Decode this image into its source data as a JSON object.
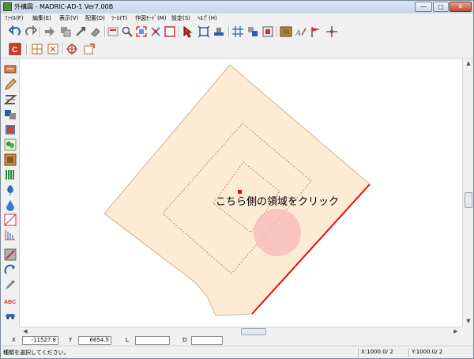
{
  "window": {
    "title": "外構図 - MADRIC-AD-1 Ver7.00B",
    "minimize_glyph": "—",
    "maximize_glyph": "□",
    "close_glyph": "✕"
  },
  "menu": [
    {
      "label": "ﾌｧｲﾙ(F)"
    },
    {
      "label": "編集(E)"
    },
    {
      "label": "表示(V)"
    },
    {
      "label": "配置(D)"
    },
    {
      "label": "ﾂｰﾙ(T)"
    },
    {
      "label": "作図ﾓｰﾄﾞ(M)"
    },
    {
      "label": "設定(S)"
    },
    {
      "label": "ﾍﾙﾌﾟ(H)"
    }
  ],
  "canvas": {
    "instruction_text": "こちら側の領域をクリック",
    "colors": {
      "region_fill": "#fdebd3",
      "region_stroke": "#c8a07a",
      "dashed": "#9a7a5a",
      "edge_highlight": "#e01010",
      "click_spot": "#f8b8b8",
      "marker": "#d01010"
    }
  },
  "coords": {
    "x_label": "X",
    "x_value": "-11527.8",
    "y_label": "Y",
    "y_value": "6654.5",
    "l_label": "L",
    "l_value": "",
    "d_label": "D",
    "d_value": ""
  },
  "status": {
    "message": "種類を選択してください。",
    "x_scale": "X:1000.0/ 2",
    "y_scale": "Y:1000.0/ 2"
  }
}
